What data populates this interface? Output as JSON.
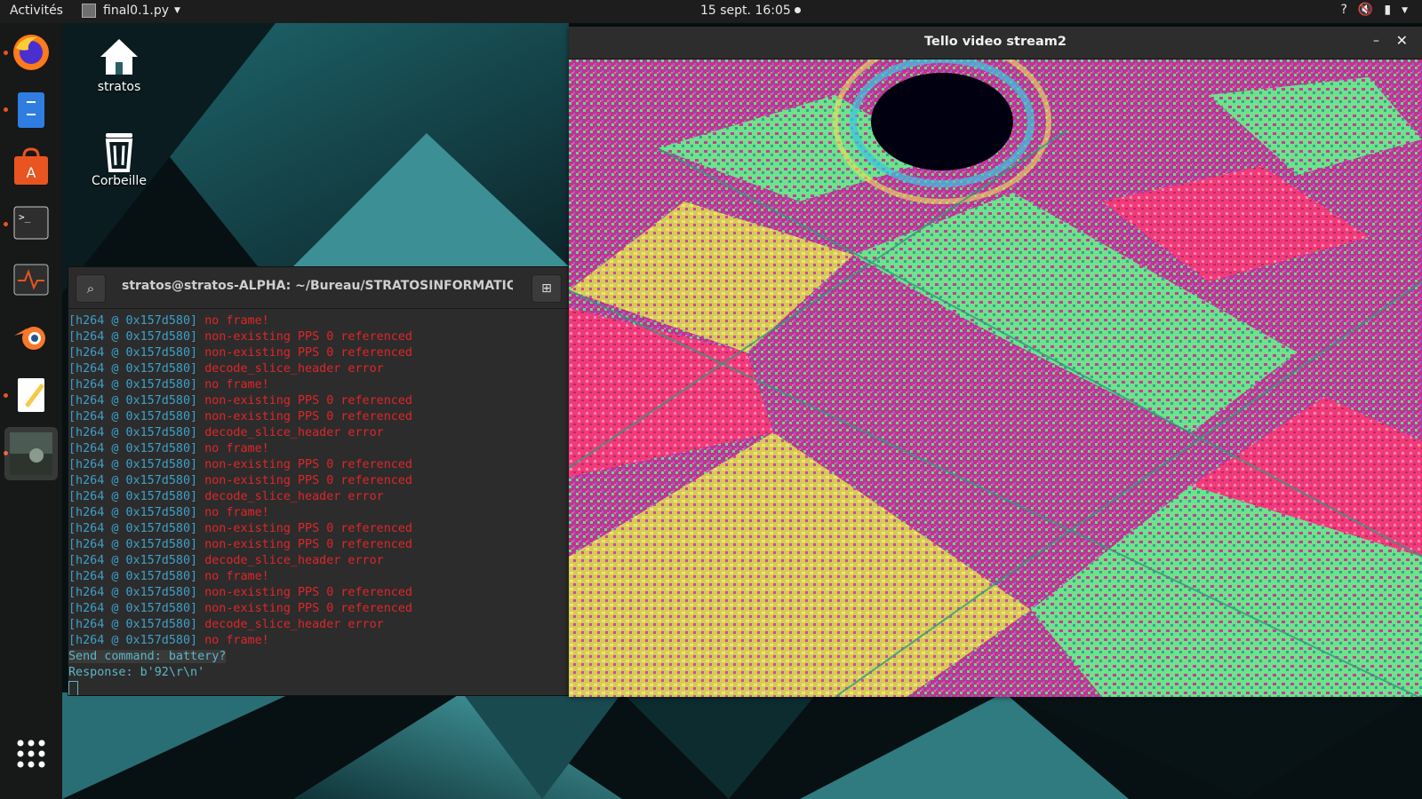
{
  "topbar": {
    "activities": "Activités",
    "app_name": "final0.1.py",
    "clock": "15 sept.  16:05"
  },
  "dock": {
    "items": [
      {
        "name": "firefox-icon",
        "running": true
      },
      {
        "name": "files-icon",
        "running": true
      },
      {
        "name": "software-center-icon",
        "running": false
      },
      {
        "name": "terminal-icon",
        "running": true
      },
      {
        "name": "system-monitor-icon",
        "running": false
      },
      {
        "name": "blender-icon",
        "running": false
      },
      {
        "name": "text-editor-icon",
        "running": true
      },
      {
        "name": "video-window-thumb",
        "running": true
      }
    ],
    "show_apps": "show-applications-icon"
  },
  "desktop": {
    "home_label": "stratos",
    "trash_label": "Corbeille"
  },
  "terminal": {
    "title": "stratos@stratos-ALPHA: ~/Bureau/STRATOSINFORMATIQU...",
    "prefix": "[h264 @ 0x157d580]",
    "log_lines": [
      "no frame!",
      "non-existing PPS 0 referenced",
      "non-existing PPS 0 referenced",
      "decode_slice_header error",
      "no frame!",
      "non-existing PPS 0 referenced",
      "non-existing PPS 0 referenced",
      "decode_slice_header error",
      "no frame!",
      "non-existing PPS 0 referenced",
      "non-existing PPS 0 referenced",
      "decode_slice_header error",
      "no frame!",
      "non-existing PPS 0 referenced",
      "non-existing PPS 0 referenced",
      "decode_slice_header error",
      "no frame!",
      "non-existing PPS 0 referenced",
      "non-existing PPS 0 referenced",
      "decode_slice_header error",
      "no frame!"
    ],
    "send_line": "Send command: battery?",
    "response_line": "Response: b'92\\r\\n'"
  },
  "video_window": {
    "title": "Tello video stream2"
  },
  "colors": {
    "accent": "#e95420",
    "log_prefix": "#3ea0c9",
    "log_error": "#e0262a",
    "prompt_text": "#5cb7c7"
  }
}
